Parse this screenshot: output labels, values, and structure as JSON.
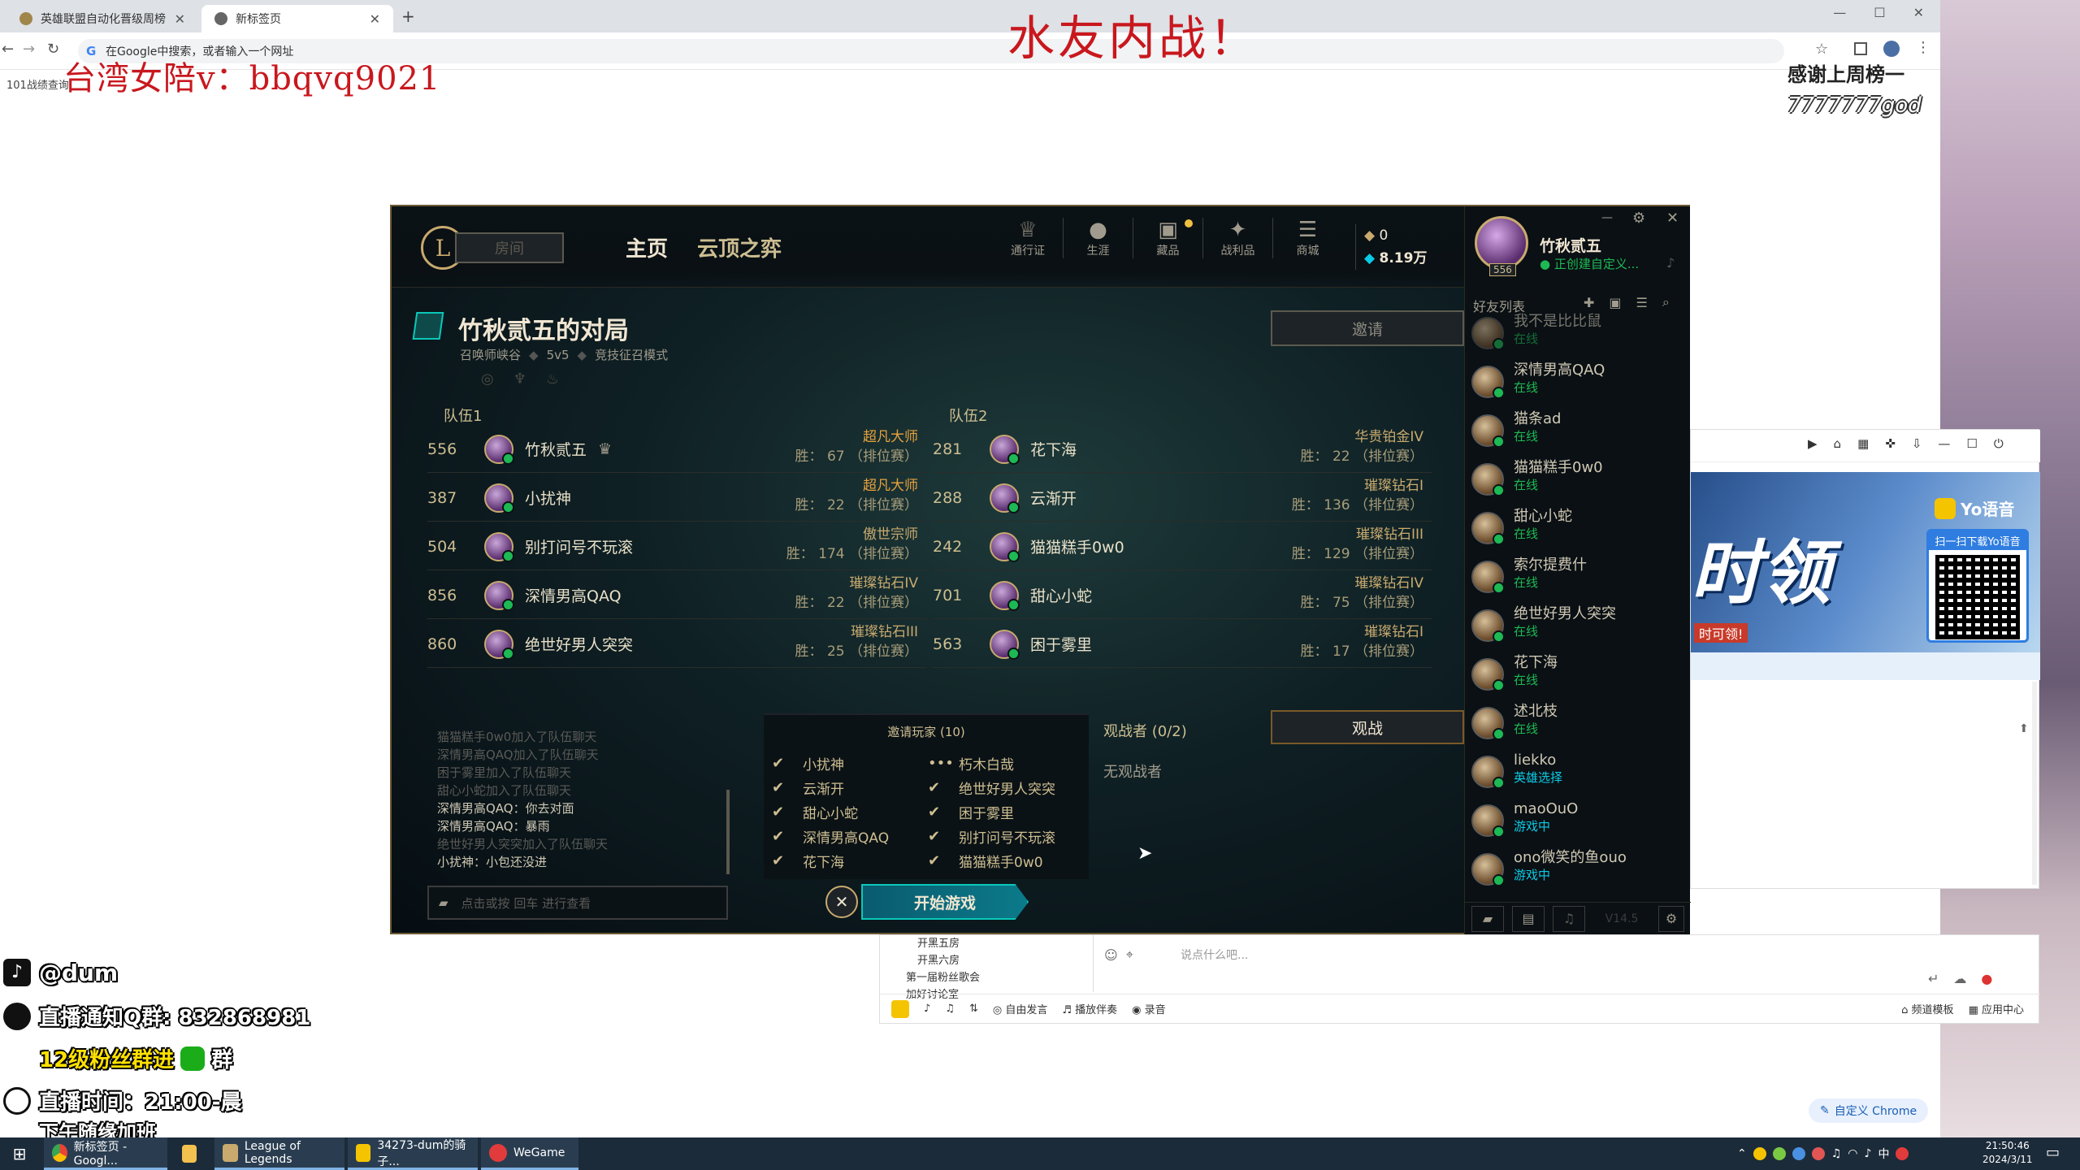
{
  "browser": {
    "tabs": [
      {
        "label": "英雄联盟自动化晋级周榜"
      },
      {
        "label": "新标签页"
      }
    ],
    "omnibox_placeholder": "在Google中搜索，或者输入一个网址",
    "bookmarks": "101战绩查询",
    "window_controls": {
      "min": "—",
      "max": "☐",
      "close": "✕"
    },
    "custom_chrome": "自定义 Chrome"
  },
  "overlay": {
    "title": "水友内战！",
    "contact": "台湾女陪v：bbqvq9021",
    "thanks": "感谢上周榜一",
    "thanks_name": "7777777god",
    "douyin": "@dum",
    "qq": "直播通知Q群: 832868981",
    "fans": "12级粉丝群进",
    "fans_suffix": "群",
    "time": "直播时间：21:00-晨",
    "time2": "下午随缘加班"
  },
  "lol": {
    "nav": {
      "room": "房间",
      "home": "主页",
      "tft": "云顶之弈",
      "icons": [
        {
          "label": "通行证"
        },
        {
          "label": "生涯"
        },
        {
          "label": "藏品"
        },
        {
          "label": "战利品"
        },
        {
          "label": "商城"
        }
      ],
      "currency1": "0",
      "currency2": "8.19万"
    },
    "profile": {
      "name": "竹秋贰五",
      "status": "正创建自定义...",
      "level": "556"
    },
    "lobby": {
      "title": "竹秋贰五的对局",
      "map": "召唤师峡谷",
      "mode": "5v5",
      "type": "竞技征召模式",
      "invite": "邀请"
    },
    "team1": {
      "label": "队伍1",
      "players": [
        {
          "level": "556",
          "name": "竹秋贰五",
          "rank": "超凡大师",
          "wins": "胜：  67  （排位赛）"
        },
        {
          "level": "387",
          "name": "小扰神",
          "rank": "超凡大师",
          "wins": "胜：  22  （排位赛）"
        },
        {
          "level": "504",
          "name": "别打问号不玩滚",
          "rank": "傲世宗师",
          "wins": "胜：  174  （排位赛）"
        },
        {
          "level": "856",
          "name": "深情男高QAQ",
          "rank": "璀璨钻石IV",
          "wins": "胜：  22  （排位赛）"
        },
        {
          "level": "860",
          "name": "绝世好男人突突",
          "rank": "璀璨钻石III",
          "wins": "胜：  25  （排位赛）"
        }
      ]
    },
    "team2": {
      "label": "队伍2",
      "players": [
        {
          "level": "281",
          "name": "花下海",
          "rank": "华贵铂金IV",
          "wins": "胜：  22  （排位赛）"
        },
        {
          "level": "288",
          "name": "云渐开",
          "rank": "璀璨钻石I",
          "wins": "胜：  136  （排位赛）"
        },
        {
          "level": "242",
          "name": "猫猫糕手0w0",
          "rank": "璀璨钻石III",
          "wins": "胜：  129  （排位赛）"
        },
        {
          "level": "701",
          "name": "甜心小蛇",
          "rank": "璀璨钻石IV",
          "wins": "胜：  75  （排位赛）"
        },
        {
          "level": "563",
          "name": "困于雾里",
          "rank": "璀璨钻石I",
          "wins": "胜：  17  （排位赛）"
        }
      ]
    },
    "chat": {
      "lines": [
        {
          "t": "猫猫糕手0w0加入了队伍聊天",
          "dim": true
        },
        {
          "t": "深情男高QAQ加入了队伍聊天",
          "dim": true
        },
        {
          "t": "困于雾里加入了队伍聊天",
          "dim": true
        },
        {
          "t": "甜心小蛇加入了队伍聊天",
          "dim": true
        },
        {
          "t": "深情男高QAQ：你去对面",
          "dim": false
        },
        {
          "t": "深情男高QAQ：暴雨",
          "dim": false
        },
        {
          "t": "绝世好男人突突加入了队伍聊天",
          "dim": true
        },
        {
          "t": "小扰神：小包还没进",
          "dim": false
        }
      ],
      "placeholder": "点击或按 回车 进行查看"
    },
    "invited": {
      "title": "邀请玩家 (10)",
      "left": [
        {
          "m": "✔",
          "n": "小扰神"
        },
        {
          "m": "✔",
          "n": "云渐开"
        },
        {
          "m": "✔",
          "n": "甜心小蛇"
        },
        {
          "m": "✔",
          "n": "深情男高QAQ"
        },
        {
          "m": "✔",
          "n": "花下海"
        }
      ],
      "right": [
        {
          "m": "•••",
          "n": "朽木白哉"
        },
        {
          "m": "✔",
          "n": "绝世好男人突突"
        },
        {
          "m": "✔",
          "n": "困于雾里"
        },
        {
          "m": "✔",
          "n": "别打问号不玩滚"
        },
        {
          "m": "✔",
          "n": "猫猫糕手0w0"
        }
      ]
    },
    "spectators": {
      "title": "观战者 (0/2)",
      "empty": "无观战者",
      "button": "观战"
    },
    "start": "开始游戏",
    "friends": {
      "title": "好友列表",
      "version": "V14.5",
      "list": [
        {
          "n": "我不是比比鼠",
          "s": "在线",
          "c": "green"
        },
        {
          "n": "深情男高QAQ",
          "s": "在线",
          "c": "green"
        },
        {
          "n": "猫条ad",
          "s": "在线",
          "c": "green"
        },
        {
          "n": "猫猫糕手0w0",
          "s": "在线",
          "c": "green"
        },
        {
          "n": "甜心小蛇",
          "s": "在线",
          "c": "green"
        },
        {
          "n": "索尔提费什",
          "s": "在线",
          "c": "green"
        },
        {
          "n": "绝世好男人突突",
          "s": "在线",
          "c": "green"
        },
        {
          "n": "花下海",
          "s": "在线",
          "c": "green"
        },
        {
          "n": "述北枝",
          "s": "在线",
          "c": "green"
        },
        {
          "n": "liekko",
          "s": "英雄选择",
          "c": "blue"
        },
        {
          "n": "maoOuO",
          "s": "游戏中",
          "c": "blue"
        },
        {
          "n": "ono微笑的鱼ouo",
          "s": "游戏中",
          "c": "blue"
        }
      ]
    }
  },
  "yy": {
    "brand": "Yo语音",
    "qr_title": "扫一扫下载Yo语音",
    "banner_text": "时领",
    "banner_sub": "时可领!",
    "tree": [
      "开黑五房",
      "开黑六房",
      "第一届粉丝歌会",
      "加好讨论室"
    ],
    "input_placeholder": "说点什么吧...",
    "bottom": {
      "free": "自由发言",
      "music": "播放伴奏",
      "record": "录音",
      "template": "频道模板",
      "app": "应用中心"
    }
  },
  "taskbar": {
    "items": [
      {
        "label": "新标签页 - Googl..."
      },
      {
        "label": ""
      },
      {
        "label": "League of Legends"
      },
      {
        "label": "34273-dum的骑子..."
      },
      {
        "label": "WeGame"
      }
    ],
    "time": "21:50:46",
    "date": "2024/3/11",
    "ime": "中"
  }
}
